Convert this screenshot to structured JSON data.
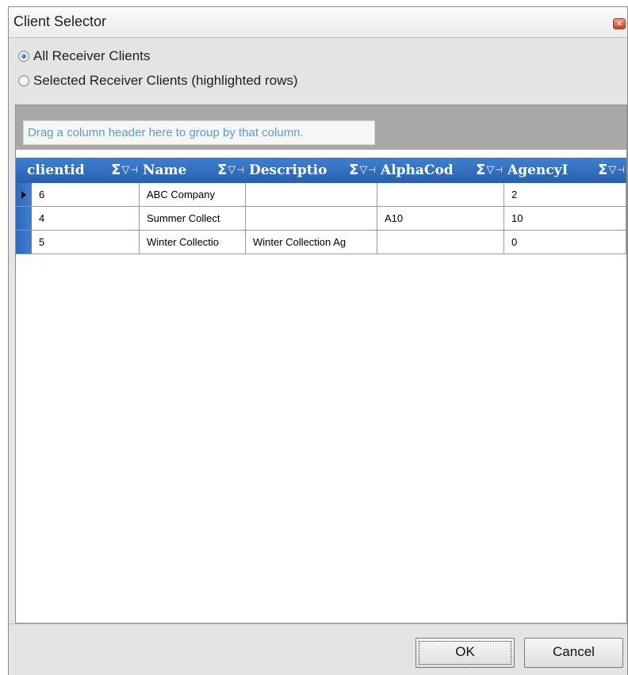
{
  "window": {
    "title": "Client Selector",
    "close_symbol": "✕"
  },
  "options": {
    "all": "All Receiver Clients",
    "selected": "Selected Receiver Clients (highlighted rows)",
    "checked": "all"
  },
  "grid": {
    "group_hint": "Drag a column header here to group by that column.",
    "columns": [
      "clientid",
      "Name",
      "Descriptio",
      "AlphaCod",
      "AgencyI"
    ],
    "column_icons": {
      "sigma": "Σ",
      "filter": "▽",
      "pin": "⊣"
    },
    "rows": [
      [
        "6",
        "ABC Company",
        "",
        "",
        "2"
      ],
      [
        "4",
        "Summer Collect",
        "",
        "A10",
        "10"
      ],
      [
        "5",
        "Winter Collectio",
        "Winter Collection Ag",
        "",
        "0"
      ]
    ],
    "current_row_index": 0
  },
  "buttons": {
    "ok": "OK",
    "cancel": "Cancel"
  }
}
